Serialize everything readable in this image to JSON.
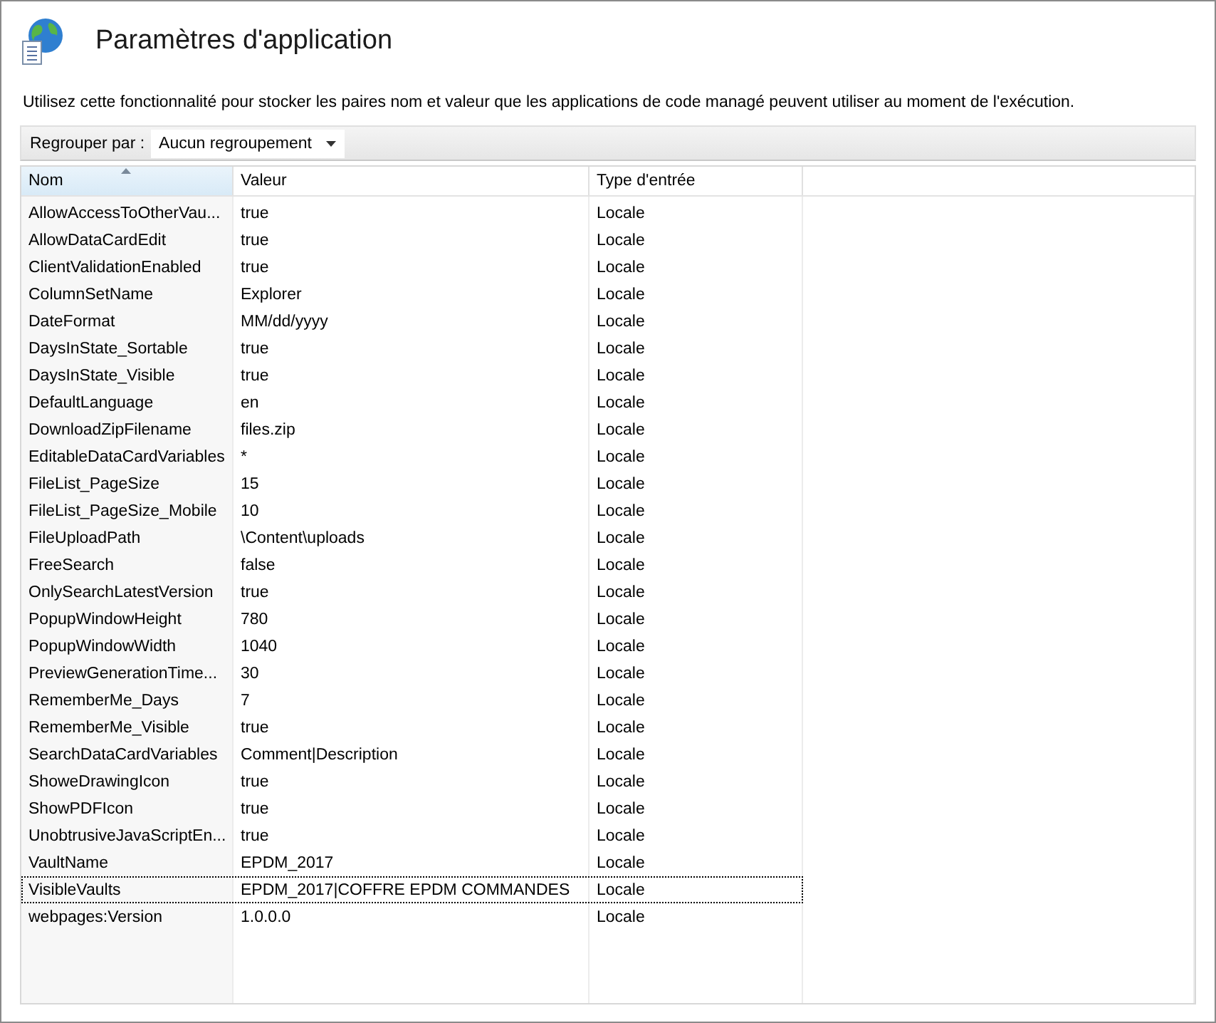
{
  "header": {
    "title": "Paramètres d'application"
  },
  "description": "Utilisez cette fonctionnalité pour stocker les paires nom et valeur que les applications de code managé peuvent utiliser au moment de l'exécution.",
  "toolbar": {
    "label": "Regrouper par :",
    "group_by": "Aucun regroupement"
  },
  "table": {
    "columns": [
      {
        "label": "Nom",
        "sorted": true
      },
      {
        "label": "Valeur",
        "sorted": false
      },
      {
        "label": "Type d'entrée",
        "sorted": false
      }
    ],
    "rows": [
      {
        "name": "AllowAccessToOtherVau...",
        "value": "true",
        "type": "Locale",
        "focused": false
      },
      {
        "name": "AllowDataCardEdit",
        "value": "true",
        "type": "Locale",
        "focused": false
      },
      {
        "name": "ClientValidationEnabled",
        "value": "true",
        "type": "Locale",
        "focused": false
      },
      {
        "name": "ColumnSetName",
        "value": "Explorer",
        "type": "Locale",
        "focused": false
      },
      {
        "name": "DateFormat",
        "value": "MM/dd/yyyy",
        "type": "Locale",
        "focused": false
      },
      {
        "name": "DaysInState_Sortable",
        "value": "true",
        "type": "Locale",
        "focused": false
      },
      {
        "name": "DaysInState_Visible",
        "value": "true",
        "type": "Locale",
        "focused": false
      },
      {
        "name": "DefaultLanguage",
        "value": "en",
        "type": "Locale",
        "focused": false
      },
      {
        "name": "DownloadZipFilename",
        "value": "files.zip",
        "type": "Locale",
        "focused": false
      },
      {
        "name": "EditableDataCardVariables",
        "value": "*",
        "type": "Locale",
        "focused": false
      },
      {
        "name": "FileList_PageSize",
        "value": "15",
        "type": "Locale",
        "focused": false
      },
      {
        "name": "FileList_PageSize_Mobile",
        "value": "10",
        "type": "Locale",
        "focused": false
      },
      {
        "name": "FileUploadPath",
        "value": "\\Content\\uploads",
        "type": "Locale",
        "focused": false
      },
      {
        "name": "FreeSearch",
        "value": "false",
        "type": "Locale",
        "focused": false
      },
      {
        "name": "OnlySearchLatestVersion",
        "value": "true",
        "type": "Locale",
        "focused": false
      },
      {
        "name": "PopupWindowHeight",
        "value": "780",
        "type": "Locale",
        "focused": false
      },
      {
        "name": "PopupWindowWidth",
        "value": "1040",
        "type": "Locale",
        "focused": false
      },
      {
        "name": "PreviewGenerationTime...",
        "value": "30",
        "type": "Locale",
        "focused": false
      },
      {
        "name": "RememberMe_Days",
        "value": "7",
        "type": "Locale",
        "focused": false
      },
      {
        "name": "RememberMe_Visible",
        "value": "true",
        "type": "Locale",
        "focused": false
      },
      {
        "name": "SearchDataCardVariables",
        "value": "Comment|Description",
        "type": "Locale",
        "focused": false
      },
      {
        "name": "ShoweDrawingIcon",
        "value": "true",
        "type": "Locale",
        "focused": false
      },
      {
        "name": "ShowPDFIcon",
        "value": "true",
        "type": "Locale",
        "focused": false
      },
      {
        "name": "UnobtrusiveJavaScriptEn...",
        "value": "true",
        "type": "Locale",
        "focused": false
      },
      {
        "name": "VaultName",
        "value": "EPDM_2017",
        "type": "Locale",
        "focused": false
      },
      {
        "name": "VisibleVaults",
        "value": "EPDM_2017|COFFRE EPDM COMMANDES",
        "type": "Locale",
        "focused": true
      },
      {
        "name": "webpages:Version",
        "value": "1.0.0.0",
        "type": "Locale",
        "focused": false
      }
    ]
  }
}
